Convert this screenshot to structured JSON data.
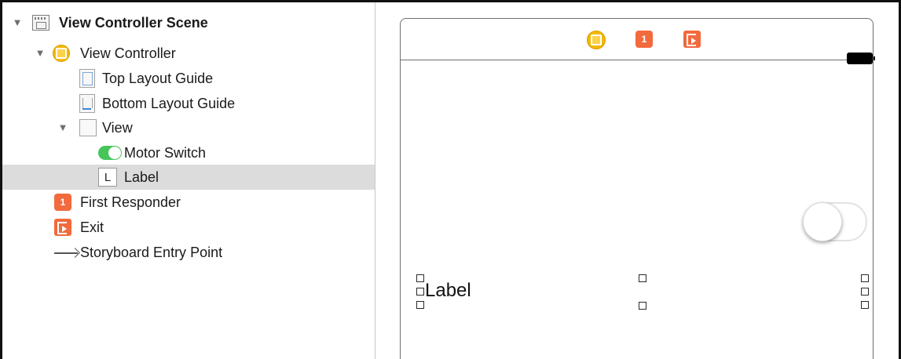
{
  "outline": {
    "items": [
      {
        "label": "View Controller Scene",
        "icon": "scene-icon",
        "disclosure": "▼"
      },
      {
        "label": "View Controller",
        "icon": "view-controller-icon",
        "disclosure": "▼"
      },
      {
        "label": "Top Layout Guide",
        "icon": "top-layout-guide-icon"
      },
      {
        "label": "Bottom Layout Guide",
        "icon": "bottom-layout-guide-icon"
      },
      {
        "label": "View",
        "icon": "view-icon",
        "disclosure": "▼"
      },
      {
        "label": "Motor Switch",
        "icon": "switch-icon"
      },
      {
        "label": "Label",
        "icon": "label-icon",
        "icon_text": "L",
        "selected": true
      },
      {
        "label": "First Responder",
        "icon": "first-responder-icon",
        "icon_text": "1"
      },
      {
        "label": "Exit",
        "icon": "exit-icon"
      },
      {
        "label": "Storyboard Entry Point",
        "icon": "arrow-icon"
      }
    ]
  },
  "canvas": {
    "scene_bar_icons": [
      "view-controller-icon",
      "first-responder-icon",
      "exit-icon"
    ],
    "first_responder_icon_text": "1",
    "label_text": "Label",
    "switch_state": "off"
  },
  "colors": {
    "selection": "#dcdcdc",
    "view_controller": "#f5b800",
    "responder_exit": "#f26a3d",
    "switch_on": "#46c65a"
  }
}
